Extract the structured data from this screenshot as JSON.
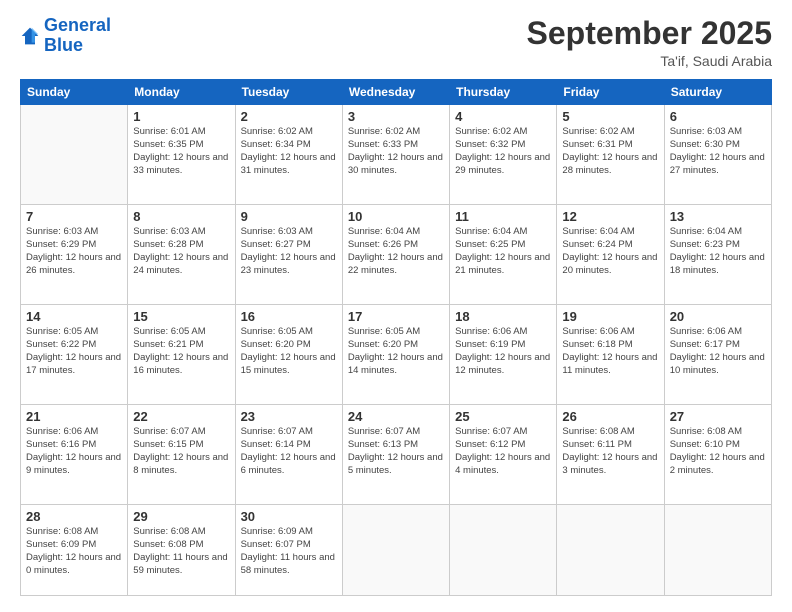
{
  "logo": {
    "line1": "General",
    "line2": "Blue"
  },
  "header": {
    "month": "September 2025",
    "location": "Ta'if, Saudi Arabia"
  },
  "weekdays": [
    "Sunday",
    "Monday",
    "Tuesday",
    "Wednesday",
    "Thursday",
    "Friday",
    "Saturday"
  ],
  "weeks": [
    [
      {
        "day": "",
        "sunrise": "",
        "sunset": "",
        "daylight": ""
      },
      {
        "day": "1",
        "sunrise": "Sunrise: 6:01 AM",
        "sunset": "Sunset: 6:35 PM",
        "daylight": "Daylight: 12 hours and 33 minutes."
      },
      {
        "day": "2",
        "sunrise": "Sunrise: 6:02 AM",
        "sunset": "Sunset: 6:34 PM",
        "daylight": "Daylight: 12 hours and 31 minutes."
      },
      {
        "day": "3",
        "sunrise": "Sunrise: 6:02 AM",
        "sunset": "Sunset: 6:33 PM",
        "daylight": "Daylight: 12 hours and 30 minutes."
      },
      {
        "day": "4",
        "sunrise": "Sunrise: 6:02 AM",
        "sunset": "Sunset: 6:32 PM",
        "daylight": "Daylight: 12 hours and 29 minutes."
      },
      {
        "day": "5",
        "sunrise": "Sunrise: 6:02 AM",
        "sunset": "Sunset: 6:31 PM",
        "daylight": "Daylight: 12 hours and 28 minutes."
      },
      {
        "day": "6",
        "sunrise": "Sunrise: 6:03 AM",
        "sunset": "Sunset: 6:30 PM",
        "daylight": "Daylight: 12 hours and 27 minutes."
      }
    ],
    [
      {
        "day": "7",
        "sunrise": "Sunrise: 6:03 AM",
        "sunset": "Sunset: 6:29 PM",
        "daylight": "Daylight: 12 hours and 26 minutes."
      },
      {
        "day": "8",
        "sunrise": "Sunrise: 6:03 AM",
        "sunset": "Sunset: 6:28 PM",
        "daylight": "Daylight: 12 hours and 24 minutes."
      },
      {
        "day": "9",
        "sunrise": "Sunrise: 6:03 AM",
        "sunset": "Sunset: 6:27 PM",
        "daylight": "Daylight: 12 hours and 23 minutes."
      },
      {
        "day": "10",
        "sunrise": "Sunrise: 6:04 AM",
        "sunset": "Sunset: 6:26 PM",
        "daylight": "Daylight: 12 hours and 22 minutes."
      },
      {
        "day": "11",
        "sunrise": "Sunrise: 6:04 AM",
        "sunset": "Sunset: 6:25 PM",
        "daylight": "Daylight: 12 hours and 21 minutes."
      },
      {
        "day": "12",
        "sunrise": "Sunrise: 6:04 AM",
        "sunset": "Sunset: 6:24 PM",
        "daylight": "Daylight: 12 hours and 20 minutes."
      },
      {
        "day": "13",
        "sunrise": "Sunrise: 6:04 AM",
        "sunset": "Sunset: 6:23 PM",
        "daylight": "Daylight: 12 hours and 18 minutes."
      }
    ],
    [
      {
        "day": "14",
        "sunrise": "Sunrise: 6:05 AM",
        "sunset": "Sunset: 6:22 PM",
        "daylight": "Daylight: 12 hours and 17 minutes."
      },
      {
        "day": "15",
        "sunrise": "Sunrise: 6:05 AM",
        "sunset": "Sunset: 6:21 PM",
        "daylight": "Daylight: 12 hours and 16 minutes."
      },
      {
        "day": "16",
        "sunrise": "Sunrise: 6:05 AM",
        "sunset": "Sunset: 6:20 PM",
        "daylight": "Daylight: 12 hours and 15 minutes."
      },
      {
        "day": "17",
        "sunrise": "Sunrise: 6:05 AM",
        "sunset": "Sunset: 6:20 PM",
        "daylight": "Daylight: 12 hours and 14 minutes."
      },
      {
        "day": "18",
        "sunrise": "Sunrise: 6:06 AM",
        "sunset": "Sunset: 6:19 PM",
        "daylight": "Daylight: 12 hours and 12 minutes."
      },
      {
        "day": "19",
        "sunrise": "Sunrise: 6:06 AM",
        "sunset": "Sunset: 6:18 PM",
        "daylight": "Daylight: 12 hours and 11 minutes."
      },
      {
        "day": "20",
        "sunrise": "Sunrise: 6:06 AM",
        "sunset": "Sunset: 6:17 PM",
        "daylight": "Daylight: 12 hours and 10 minutes."
      }
    ],
    [
      {
        "day": "21",
        "sunrise": "Sunrise: 6:06 AM",
        "sunset": "Sunset: 6:16 PM",
        "daylight": "Daylight: 12 hours and 9 minutes."
      },
      {
        "day": "22",
        "sunrise": "Sunrise: 6:07 AM",
        "sunset": "Sunset: 6:15 PM",
        "daylight": "Daylight: 12 hours and 8 minutes."
      },
      {
        "day": "23",
        "sunrise": "Sunrise: 6:07 AM",
        "sunset": "Sunset: 6:14 PM",
        "daylight": "Daylight: 12 hours and 6 minutes."
      },
      {
        "day": "24",
        "sunrise": "Sunrise: 6:07 AM",
        "sunset": "Sunset: 6:13 PM",
        "daylight": "Daylight: 12 hours and 5 minutes."
      },
      {
        "day": "25",
        "sunrise": "Sunrise: 6:07 AM",
        "sunset": "Sunset: 6:12 PM",
        "daylight": "Daylight: 12 hours and 4 minutes."
      },
      {
        "day": "26",
        "sunrise": "Sunrise: 6:08 AM",
        "sunset": "Sunset: 6:11 PM",
        "daylight": "Daylight: 12 hours and 3 minutes."
      },
      {
        "day": "27",
        "sunrise": "Sunrise: 6:08 AM",
        "sunset": "Sunset: 6:10 PM",
        "daylight": "Daylight: 12 hours and 2 minutes."
      }
    ],
    [
      {
        "day": "28",
        "sunrise": "Sunrise: 6:08 AM",
        "sunset": "Sunset: 6:09 PM",
        "daylight": "Daylight: 12 hours and 0 minutes."
      },
      {
        "day": "29",
        "sunrise": "Sunrise: 6:08 AM",
        "sunset": "Sunset: 6:08 PM",
        "daylight": "Daylight: 11 hours and 59 minutes."
      },
      {
        "day": "30",
        "sunrise": "Sunrise: 6:09 AM",
        "sunset": "Sunset: 6:07 PM",
        "daylight": "Daylight: 11 hours and 58 minutes."
      },
      {
        "day": "",
        "sunrise": "",
        "sunset": "",
        "daylight": ""
      },
      {
        "day": "",
        "sunrise": "",
        "sunset": "",
        "daylight": ""
      },
      {
        "day": "",
        "sunrise": "",
        "sunset": "",
        "daylight": ""
      },
      {
        "day": "",
        "sunrise": "",
        "sunset": "",
        "daylight": ""
      }
    ]
  ]
}
